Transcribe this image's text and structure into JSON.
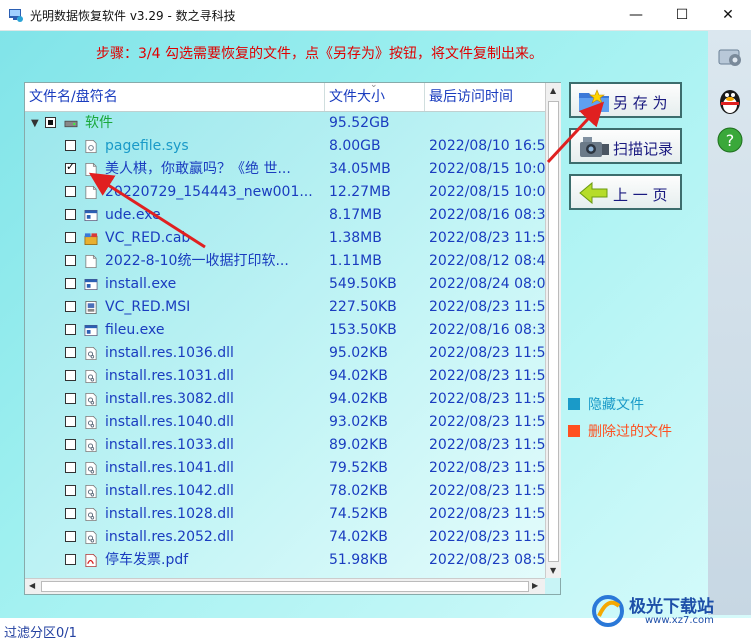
{
  "window": {
    "title": "光明数据恢复软件 v3.29 - 数之寻科技"
  },
  "controls": {
    "minimize": "—",
    "maximize": "☐",
    "close": "✕"
  },
  "instruction": "步骤：3/4 勾选需要恢复的文件，点《另存为》按钮，将文件复制出来。",
  "columns": {
    "name": "文件名/盘符名",
    "size": "文件大小",
    "time": "最后访问时间"
  },
  "rows": [
    {
      "name": "软件",
      "size": "95.52GB",
      "time": "",
      "level": 0,
      "check": "partial",
      "icon": "drive-icon",
      "color": "#1aa83a"
    },
    {
      "name": "pagefile.sys",
      "size": "8.00GB",
      "time": "2022/08/10 16:5",
      "level": 1,
      "check": "none",
      "icon": "system-file-icon",
      "color": "#1a9ac8"
    },
    {
      "name": "美人棋，你敢赢吗？《绝 世...",
      "size": "34.05MB",
      "time": "2022/08/15 10:0",
      "level": 1,
      "check": "checked",
      "icon": "blank-file-icon",
      "color": "#1a3cbf"
    },
    {
      "name": "20220729_154443_new001...",
      "size": "12.27MB",
      "time": "2022/08/15 10:0",
      "level": 1,
      "check": "none",
      "icon": "blank-file-icon",
      "color": "#1a3cbf"
    },
    {
      "name": "ude.exe",
      "size": "8.17MB",
      "time": "2022/08/16 08:3",
      "level": 1,
      "check": "none",
      "icon": "exe-icon",
      "color": "#1a3cbf"
    },
    {
      "name": "VC_RED.cab",
      "size": "1.38MB",
      "time": "2022/08/23 11:5",
      "level": 1,
      "check": "none",
      "icon": "cab-icon",
      "color": "#1a3cbf"
    },
    {
      "name": "2022-8-10统一收据打印软...",
      "size": "1.11MB",
      "time": "2022/08/12 08:4",
      "level": 1,
      "check": "none",
      "icon": "blank-file-icon",
      "color": "#1a3cbf"
    },
    {
      "name": "install.exe",
      "size": "549.50KB",
      "time": "2022/08/24 08:0",
      "level": 1,
      "check": "none",
      "icon": "exe-icon",
      "color": "#1a3cbf"
    },
    {
      "name": "VC_RED.MSI",
      "size": "227.50KB",
      "time": "2022/08/23 11:5",
      "level": 1,
      "check": "none",
      "icon": "msi-icon",
      "color": "#1a3cbf"
    },
    {
      "name": "fileu.exe",
      "size": "153.50KB",
      "time": "2022/08/16 08:3",
      "level": 1,
      "check": "none",
      "icon": "exe-icon",
      "color": "#1a3cbf"
    },
    {
      "name": "install.res.1036.dll",
      "size": "95.02KB",
      "time": "2022/08/23 11:5",
      "level": 1,
      "check": "none",
      "icon": "dll-icon",
      "color": "#1a3cbf"
    },
    {
      "name": "install.res.1031.dll",
      "size": "94.02KB",
      "time": "2022/08/23 11:5",
      "level": 1,
      "check": "none",
      "icon": "dll-icon",
      "color": "#1a3cbf"
    },
    {
      "name": "install.res.3082.dll",
      "size": "94.02KB",
      "time": "2022/08/23 11:5",
      "level": 1,
      "check": "none",
      "icon": "dll-icon",
      "color": "#1a3cbf"
    },
    {
      "name": "install.res.1040.dll",
      "size": "93.02KB",
      "time": "2022/08/23 11:5",
      "level": 1,
      "check": "none",
      "icon": "dll-icon",
      "color": "#1a3cbf"
    },
    {
      "name": "install.res.1033.dll",
      "size": "89.02KB",
      "time": "2022/08/23 11:5",
      "level": 1,
      "check": "none",
      "icon": "dll-icon",
      "color": "#1a3cbf"
    },
    {
      "name": "install.res.1041.dll",
      "size": "79.52KB",
      "time": "2022/08/23 11:5",
      "level": 1,
      "check": "none",
      "icon": "dll-icon",
      "color": "#1a3cbf"
    },
    {
      "name": "install.res.1042.dll",
      "size": "78.02KB",
      "time": "2022/08/23 11:5",
      "level": 1,
      "check": "none",
      "icon": "dll-icon",
      "color": "#1a3cbf"
    },
    {
      "name": "install.res.1028.dll",
      "size": "74.52KB",
      "time": "2022/08/23 11:5",
      "level": 1,
      "check": "none",
      "icon": "dll-icon",
      "color": "#1a3cbf"
    },
    {
      "name": "install.res.2052.dll",
      "size": "74.02KB",
      "time": "2022/08/23 11:5",
      "level": 1,
      "check": "none",
      "icon": "dll-icon",
      "color": "#1a3cbf"
    },
    {
      "name": "停车发票.pdf",
      "size": "51.98KB",
      "time": "2022/08/23 08:5",
      "level": 1,
      "check": "none",
      "icon": "pdf-icon",
      "color": "#1a3cbf"
    }
  ],
  "buttons": {
    "save_as": "另 存 为",
    "scan_log": "扫描记录",
    "prev_page": "上 一 页"
  },
  "legend": [
    {
      "label": "隐藏文件",
      "color": "#1a9ac8"
    },
    {
      "label": "删除过的文件",
      "color": "#ff5020"
    }
  ],
  "status": "过滤分区0/1",
  "watermark": {
    "text": "极光下载站",
    "url": "www.xz7.com"
  },
  "colors": {
    "arrow": "#e02020",
    "title_red": "#e00000",
    "text_blue": "#1a3cbf"
  }
}
